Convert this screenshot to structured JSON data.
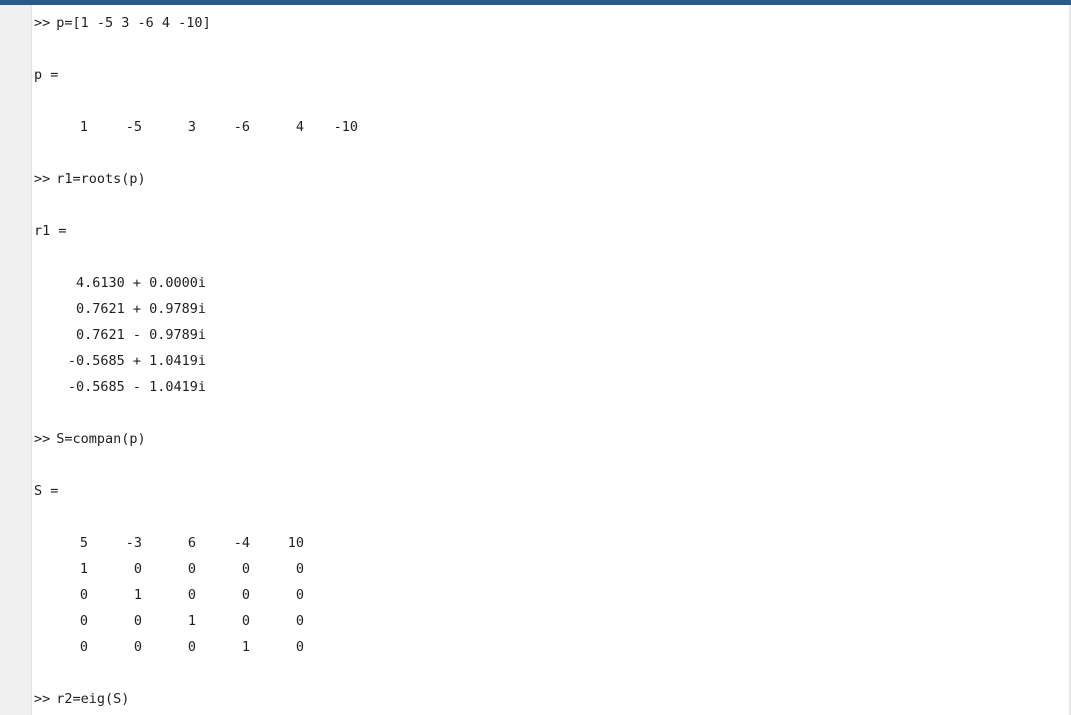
{
  "prompt_symbol": ">>",
  "commands": [
    "p=[1 -5 3 -6 4 -10]",
    "r1=roots(p)",
    "S=compan(p)",
    "r2=eig(S)"
  ],
  "outputs": {
    "p": {
      "label": "p =",
      "values": [
        "1",
        "-5",
        "3",
        "-6",
        "4",
        "-10"
      ]
    },
    "r1": {
      "label": "r1 =",
      "values": [
        "4.6130 + 0.0000i",
        "0.7621 + 0.9789i",
        "0.7621 - 0.9789i",
        "-0.5685 + 1.0419i",
        "-0.5685 - 1.0419i"
      ]
    },
    "S": {
      "label": "S =",
      "rows": [
        [
          "5",
          "-3",
          "6",
          "-4",
          "10"
        ],
        [
          "1",
          "0",
          "0",
          "0",
          "0"
        ],
        [
          "0",
          "1",
          "0",
          "0",
          "0"
        ],
        [
          "0",
          "0",
          "1",
          "0",
          "0"
        ],
        [
          "0",
          "0",
          "0",
          "1",
          "0"
        ]
      ]
    }
  }
}
